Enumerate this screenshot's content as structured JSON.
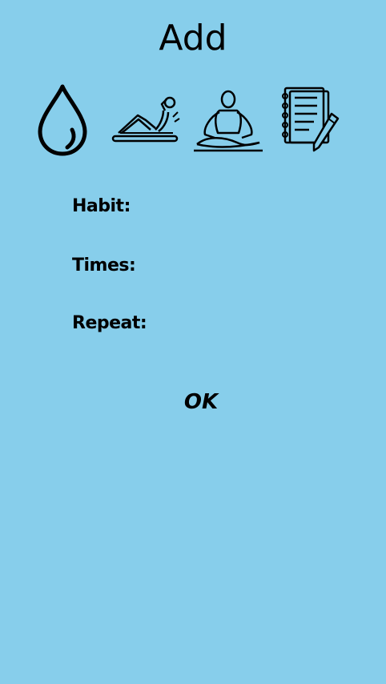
{
  "header": {
    "title": "Add"
  },
  "habit_icons": [
    {
      "name": "water-drop-icon"
    },
    {
      "name": "exercise-icon"
    },
    {
      "name": "meditation-icon"
    },
    {
      "name": "notes-icon"
    }
  ],
  "form": {
    "habit_label": "Habit:",
    "times_label": "Times:",
    "repeat_label": "Repeat:"
  },
  "actions": {
    "ok_label": "OK"
  },
  "colors": {
    "background": "#87CEEB",
    "text": "#000000"
  }
}
